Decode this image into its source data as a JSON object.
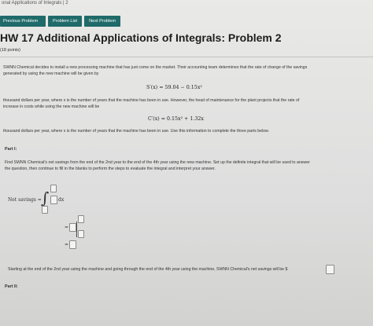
{
  "breadcrumb": "onal Applications of Integrals  |  2",
  "nav": {
    "previous": "Previous Problem",
    "list": "Problem List",
    "next": "Next Problem"
  },
  "title": "HW 17 Additional Applications of Integrals: Problem 2",
  "points": "(18 points)",
  "problem": {
    "intro_line1": "SWNN Chemical decides to install a new processing machine that has just come on the market. Their accounting team determines that the rate of change of the savings",
    "intro_line2": "generated by using the new machine will be given by",
    "savings_eq": "S′(x) = 59.04 − 0.15x²",
    "mid_line1": "thousand dollars per year, where x is the number of years that the machine has been in use. However, the head of maintenance for the plant projects that the rate of",
    "mid_line2": "increase in costs while using the new machine will be",
    "cost_eq": "C′(x) = 0.15x² + 1.32x",
    "end_line": "thousand dollars per year, where x is the number of years that the machine has been in use. Use this information to complete the three parts below."
  },
  "part1": {
    "label": "Part I:",
    "line1": "Find SWNN Chemical's net savings from the end of the 2nd year to the end of the 4th year using the new machine. Set up the definite integral that will be used to answer",
    "line2": "the question, then continue to fill in the blanks to perform the steps to evaluate the integral and interpret your answer.",
    "net_savings_label": "Net savings =",
    "integral_sign": "∫",
    "dx": "dx",
    "equals1": "=",
    "equals2": "=",
    "interpret": "Starting at the end of the 2nd year using the machine and going through the end of the 4th year using the machine, SWNN Chemical's net savings will be $"
  },
  "part2": {
    "label": "Part II:"
  }
}
